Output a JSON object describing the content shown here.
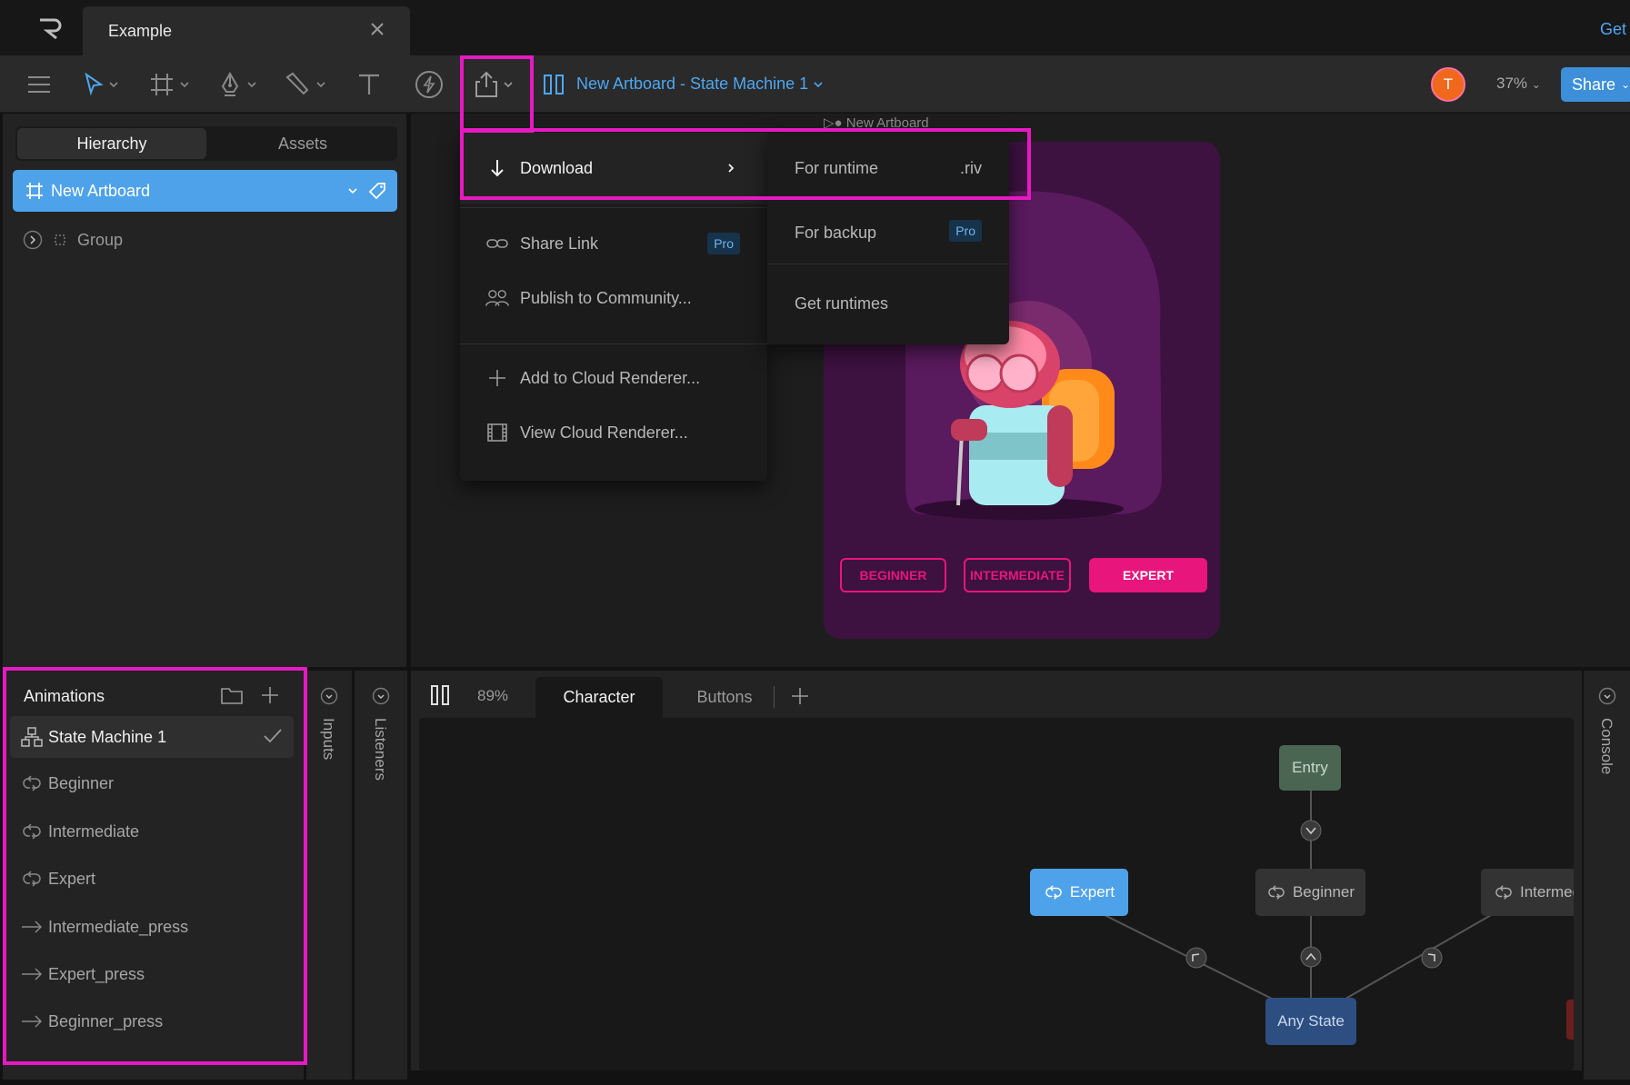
{
  "app": {
    "name": "Rive",
    "tab_title": "Example",
    "get_link": "Get"
  },
  "toolbar": {
    "artboard_title": "New Artboard - State Machine 1",
    "zoom": "37%",
    "share_label": "Share",
    "avatar_initial": "T"
  },
  "left_panel": {
    "tabs": [
      "Hierarchy",
      "Assets"
    ],
    "active_tab": "Hierarchy",
    "artboard": "New Artboard",
    "group": "Group"
  },
  "canvas": {
    "artboard_label": "New Artboard",
    "buttons": [
      {
        "label": "BEGINNER",
        "active": false
      },
      {
        "label": "INTERMEDIATE",
        "active": false
      },
      {
        "label": "EXPERT",
        "active": true
      }
    ]
  },
  "export_menu": {
    "items": [
      {
        "label": "Download",
        "icon": "download-arrow-icon",
        "has_submenu": true
      },
      {
        "label": "Share Link",
        "icon": "link-icon",
        "badge": "Pro"
      },
      {
        "label": "Publish to Community...",
        "icon": "users-icon"
      },
      {
        "label": "Add to Cloud Renderer...",
        "icon": "plus-icon"
      },
      {
        "label": "View Cloud Renderer...",
        "icon": "film-icon"
      }
    ],
    "submenu": [
      {
        "label": "For runtime",
        "suffix": ".riv"
      },
      {
        "label": "For backup",
        "badge": "Pro"
      },
      {
        "label": "Get runtimes"
      }
    ]
  },
  "animations": {
    "title": "Animations",
    "items": [
      {
        "label": "State Machine 1",
        "type": "state-machine",
        "selected": true
      },
      {
        "label": "Beginner",
        "type": "loop"
      },
      {
        "label": "Intermediate",
        "type": "loop"
      },
      {
        "label": "Expert",
        "type": "loop"
      },
      {
        "label": "Intermediate_press",
        "type": "oneshot"
      },
      {
        "label": "Expert_press",
        "type": "oneshot"
      },
      {
        "label": "Beginner_press",
        "type": "oneshot"
      }
    ]
  },
  "side_tabs": {
    "inputs": "Inputs",
    "listeners": "Listeners",
    "console": "Console"
  },
  "state_machine": {
    "zoom": "89%",
    "layers": [
      "Character",
      "Buttons"
    ],
    "active_layer": "Character",
    "nodes": {
      "entry": "Entry",
      "expert": "Expert",
      "beginner": "Beginner",
      "intermediate": "Intermediate",
      "any_state": "Any State"
    }
  },
  "colors": {
    "accent": "#4ea7f2",
    "highlight": "#e619c2",
    "brand_pink": "#e8157c",
    "artboard_bg": "#3d1140"
  }
}
